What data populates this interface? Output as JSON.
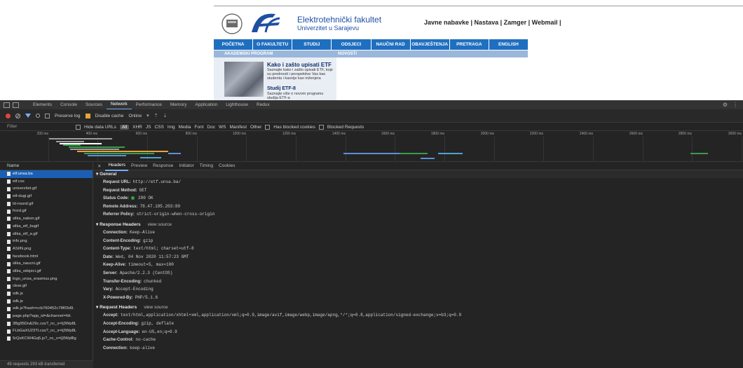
{
  "site": {
    "brand_name": "Elektrotehnički fakultet",
    "brand_sub": "Univerzitet u Sarajevu",
    "top_links": "Javne nabavke | Nastava | Zamger | Webmail |",
    "nav": [
      "POČETNA",
      "O FAKULTETU",
      "STUDIJ",
      "ODSJECI",
      "NAUČNI RAD",
      "OBAVJEŠTENJA",
      "PRETRAGA",
      "ENGLISH"
    ],
    "section_left": "AKADEMSKI PROGRAM",
    "section_right": "NOVOSTI",
    "article1_title": "Kako i zašto upisati ETF",
    "article1_text": "Saznajte kako i zašto upisati ETF, koje su prednosti i perspektive Vas kao studenta i kasnije kao inženjera",
    "article2_title": "Studij ETF-8",
    "article2_text": "Saznajte više o novom programu studija ETF-a"
  },
  "devtools": {
    "tabs": [
      "Elements",
      "Console",
      "Sources",
      "Network",
      "Performance",
      "Memory",
      "Application",
      "Lighthouse",
      "Redux"
    ],
    "active_tab": "Network",
    "toolbar": {
      "preserve_log": "Preserve log",
      "disable_cache": "Disable cache",
      "throttle": "Online"
    },
    "filter": {
      "label": "Filter",
      "hide_data_urls": "Hide data URLs",
      "all": "All",
      "types": [
        "XHR",
        "JS",
        "CSS",
        "Img",
        "Media",
        "Font",
        "Doc",
        "WS",
        "Manifest",
        "Other"
      ],
      "has_blocked_cookies": "Has blocked cookies",
      "blocked_requests": "Blocked Requests"
    },
    "timeline_ticks": [
      "200 ms",
      "400 ms",
      "600 ms",
      "800 ms",
      "1000 ms",
      "1200 ms",
      "1400 ms",
      "1600 ms",
      "1800 ms",
      "2000 ms",
      "2200 ms",
      "2400 ms",
      "2600 ms",
      "2800 ms",
      "3000 ms"
    ],
    "name_header": "Name",
    "requests": [
      "etf.unsa.ba",
      "etf.css",
      "univerzitet.gif",
      "etf-dugi.gif",
      "td-round.gif",
      "frord.gif",
      "slika_nakon.gif",
      "slika_etf_bugif",
      "slika_etf_a.gif",
      "info.png",
      "ASIIN.png",
      "facebook.html",
      "slika_naucni.gif",
      "slika_odsjeci.gif",
      "logo_unsa_erasmus.png",
      "clear.gif",
      "sdk.js",
      "sdk.js",
      "sdk.js?hash=ccb760452c78f03d9.",
      "page.php?app_id=&channel=htt.",
      "3Bg95Dn&29c.css?_nc_x=Ij3Wp8L",
      "FLbGaXU23Tt.css?_nc_x=Ij3Wp8L",
      "5rQsKCW4Gq5.js?_nc_x=Ij3Wp8lg"
    ],
    "status_bar": "49 requests  293 kB transferred",
    "sub_tabs": [
      "Headers",
      "Preview",
      "Response",
      "Initiator",
      "Timing",
      "Cookies"
    ],
    "general": {
      "title": "General",
      "rows": [
        {
          "k": "Request URL:",
          "v": "http://etf.unsa.ba/"
        },
        {
          "k": "Request Method:",
          "v": "GET"
        },
        {
          "k": "Status Code:",
          "v": "200 OK"
        },
        {
          "k": "Remote Address:",
          "v": "78.47.195.203:80"
        },
        {
          "k": "Referrer Policy:",
          "v": "strict-origin-when-cross-origin"
        }
      ]
    },
    "response_headers": {
      "title": "Response Headers",
      "view_source": "view source",
      "rows": [
        {
          "k": "Connection:",
          "v": "Keep-Alive"
        },
        {
          "k": "Content-Encoding:",
          "v": "gzip"
        },
        {
          "k": "Content-Type:",
          "v": "text/html; charset=utf-8"
        },
        {
          "k": "Date:",
          "v": "Wed, 04 Nov 2020 11:57:23 GMT"
        },
        {
          "k": "Keep-Alive:",
          "v": "timeout=5, max=100"
        },
        {
          "k": "Server:",
          "v": "Apache/2.2.3 (CentOS)"
        },
        {
          "k": "Transfer-Encoding:",
          "v": "chunked"
        },
        {
          "k": "Vary:",
          "v": "Accept-Encoding"
        },
        {
          "k": "X-Powered-By:",
          "v": "PHP/5.1.6"
        }
      ]
    },
    "request_headers": {
      "title": "Request Headers",
      "view_source": "view source",
      "rows": [
        {
          "k": "Accept:",
          "v": "text/html,application/xhtml+xml,application/xml;q=0.9,image/avif,image/webp,image/apng,*/*;q=0.8,application/signed-exchange;v=b3;q=0.9"
        },
        {
          "k": "Accept-Encoding:",
          "v": "gzip, deflate"
        },
        {
          "k": "Accept-Language:",
          "v": "en-US,en;q=0.9"
        },
        {
          "k": "Cache-Control:",
          "v": "no-cache"
        },
        {
          "k": "Connection:",
          "v": "keep-alive"
        }
      ]
    },
    "colors": {
      "accent": "#7cacf8",
      "selected_row": "#1a5fb4",
      "record": "#e0463b",
      "status_ok": "#29a745"
    }
  }
}
